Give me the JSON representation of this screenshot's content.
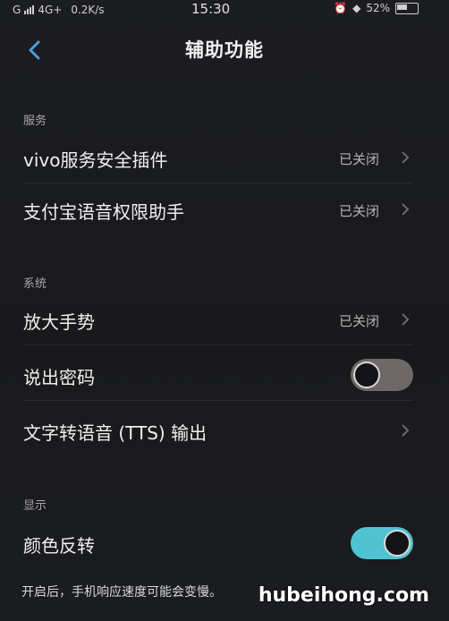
{
  "status_bar": {
    "carrier": "G",
    "network": "4G+",
    "speed": "0.2K/s",
    "time": "15:30",
    "battery": "52%"
  },
  "header": {
    "title": "辅助功能"
  },
  "sections": {
    "service": {
      "label": "服务",
      "items": [
        {
          "label": "vivo服务安全插件",
          "value": "已关闭"
        },
        {
          "label": "支付宝语音权限助手",
          "value": "已关闭"
        }
      ]
    },
    "system": {
      "label": "系统",
      "items": [
        {
          "label": "放大手势",
          "value": "已关闭"
        },
        {
          "label": "说出密码",
          "toggle": "off"
        },
        {
          "label": "文字转语音 (TTS) 输出"
        }
      ]
    },
    "display": {
      "label": "显示",
      "items": [
        {
          "label": "颜色反转",
          "toggle": "on"
        }
      ],
      "footnote": "开启后，手机响应速度可能会变慢。"
    }
  },
  "watermark": "hubeihong.com",
  "colors": {
    "background": "#1a1b1e",
    "toggle_on": "#4fc3d1",
    "toggle_off": "#6e6868",
    "accent_back": "#4a9fe0"
  }
}
